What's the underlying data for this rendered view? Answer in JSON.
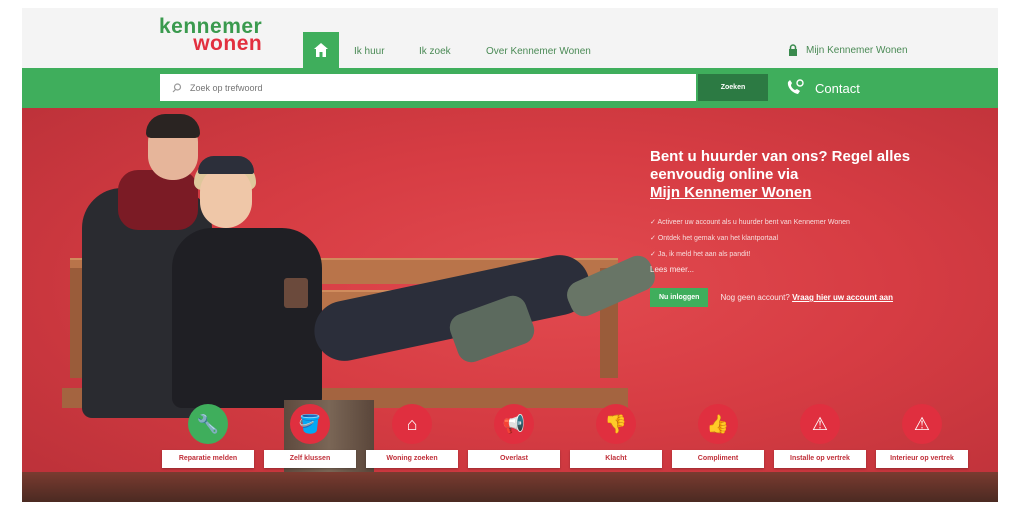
{
  "brand": {
    "line1": "kennemer",
    "line2": "wonen"
  },
  "nav": {
    "links": [
      "Ik huur",
      "Ik zoek",
      "Over Kennemer Wonen"
    ],
    "account_label": "Mijn Kennemer Wonen"
  },
  "search": {
    "placeholder": "Zoek op trefwoord",
    "button_label": "Zoeken"
  },
  "contact": {
    "label": "Contact"
  },
  "hero": {
    "heading_line1": "Bent u huurder van ons? Regel alles",
    "heading_line2": "eenvoudig online via",
    "heading_link": "Mijn Kennemer Wonen",
    "bullets": [
      "Activeer uw account als u huurder bent van Kennemer Wonen",
      "Ontdek het gemak van het klantportaal",
      "Ja, ik meld het aan als pandit!"
    ],
    "more_link": "Lees meer...",
    "login_button": "Nu inloggen",
    "register_text": "Nog geen account?",
    "register_link": "Vraag hier uw account aan"
  },
  "quick_actions": [
    {
      "label": "Reparatie melden",
      "icon": "wrench-icon",
      "glyph": "🔧",
      "color": "green"
    },
    {
      "label": "Zelf klussen",
      "icon": "paint-bucket-icon",
      "glyph": "🪣",
      "color": "red"
    },
    {
      "label": "Woning zoeken",
      "icon": "house-icon",
      "glyph": "⌂",
      "color": "red"
    },
    {
      "label": "Overlast",
      "icon": "megaphone-icon",
      "glyph": "📢",
      "color": "red"
    },
    {
      "label": "Klacht",
      "icon": "thumbs-down-icon",
      "glyph": "👎",
      "color": "red"
    },
    {
      "label": "Compliment",
      "icon": "thumbs-up-icon",
      "glyph": "👍",
      "color": "red"
    },
    {
      "label": "Installe op vertrek",
      "icon": "moving-icon",
      "glyph": "⚠",
      "color": "red"
    },
    {
      "label": "Interieur op vertrek",
      "icon": "moving-boxes-icon",
      "glyph": "⚠",
      "color": "red"
    }
  ],
  "colors": {
    "brand_green": "#3fae5c",
    "brand_red": "#e2303f",
    "dark_green": "#2c7a43"
  }
}
